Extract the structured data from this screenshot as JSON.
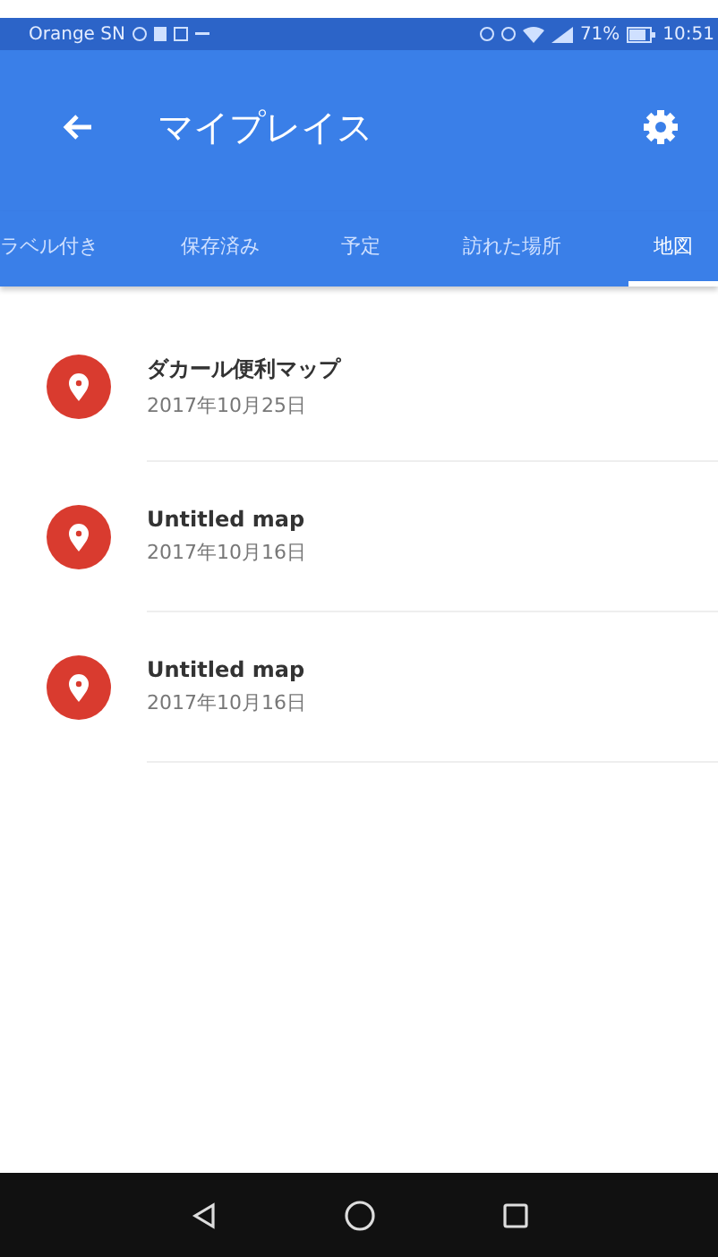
{
  "status_bar": {
    "carrier": "Orange SN",
    "battery": "71%",
    "time": "10:51"
  },
  "app_bar": {
    "title": "マイプレイス"
  },
  "tabs": [
    {
      "label": "ラベル付き",
      "selected": false
    },
    {
      "label": "保存済み",
      "selected": false
    },
    {
      "label": "予定",
      "selected": false
    },
    {
      "label": "訪れた場所",
      "selected": false
    },
    {
      "label": "地図",
      "selected": true
    }
  ],
  "maps": [
    {
      "title": "ダカール便利マップ",
      "date": "2017年10月25日"
    },
    {
      "title": "Untitled map",
      "date": "2017年10月16日"
    },
    {
      "title": "Untitled map",
      "date": "2017年10月16日"
    }
  ]
}
